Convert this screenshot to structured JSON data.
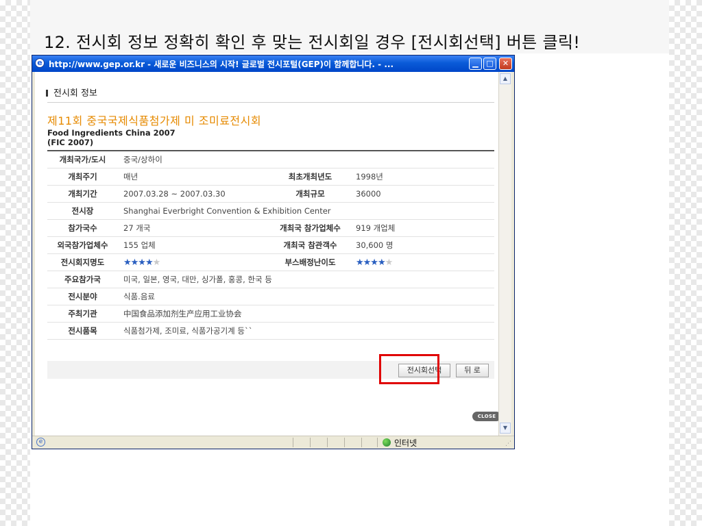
{
  "slide": {
    "title": "12. 전시회 정보 정확히 확인 후 맞는 전시회일 경우 [전시회선택] 버튼 클릭!"
  },
  "window": {
    "title": "http://www.gep.or.kr - 새로운 비즈니스의 시작! 글로벌 전시포털(GEP)이 함께합니다. - ...",
    "minimize_icon": "minimize-icon",
    "maximize_icon": "maximize-icon",
    "close_icon": "close-icon"
  },
  "section": {
    "title": "전시회 정보"
  },
  "exhibition": {
    "name_korean": "제11회 중국국제식품첨가제 미 조미료전시회",
    "name_english": "Food Ingredients China 2007",
    "abbr": "(FIC 2007)"
  },
  "info": {
    "country_label": "개최국가/도시",
    "country_value": "중국/상하이",
    "cycle_label": "개최주기",
    "cycle_value": "매년",
    "first_year_label": "최초개최년도",
    "first_year_value": "1998년",
    "period_label": "개최기간",
    "period_value": "2007.03.28 ~ 2007.03.30",
    "scale_label": "개최규모",
    "scale_value": "36000",
    "venue_label": "전시장",
    "venue_value": "Shanghai Everbright Convention & Exhibition Center",
    "countries_label": "참가국수",
    "countries_value": "27 개국",
    "host_companies_label": "개최국 참가업체수",
    "host_companies_value": "919 개업체",
    "foreign_companies_label": "외국참가업체수",
    "foreign_companies_value": "155 업체",
    "visitors_label": "개최국 참관객수",
    "visitors_value": "30,600 명",
    "awareness_label": "전시회지명도",
    "awareness_rating": 4,
    "booth_label": "부스배정난이도",
    "booth_rating": 4,
    "main_countries_label": "주요참가국",
    "main_countries_value": "미국, 일본, 영국, 대만, 싱가폴, 홍콩, 한국 등",
    "field_label": "전시분야",
    "field_value": "식품.음료",
    "organizer_label": "주최기관",
    "organizer_value": "中国食品添加剂生产应用工业协会",
    "items_label": "전시품목",
    "items_value": "식품첨가제, 조미료, 식품가공기계 등``"
  },
  "buttons": {
    "select": "전시회선택",
    "back": "뒤 로",
    "close": "CLOSE"
  },
  "statusbar": {
    "zone": "인터넷"
  },
  "colors": {
    "highlight": "#e00000",
    "title_orange": "#e68a00",
    "titlebar_blue": "#0a5bd8",
    "star_blue": "#2a5fc0"
  }
}
